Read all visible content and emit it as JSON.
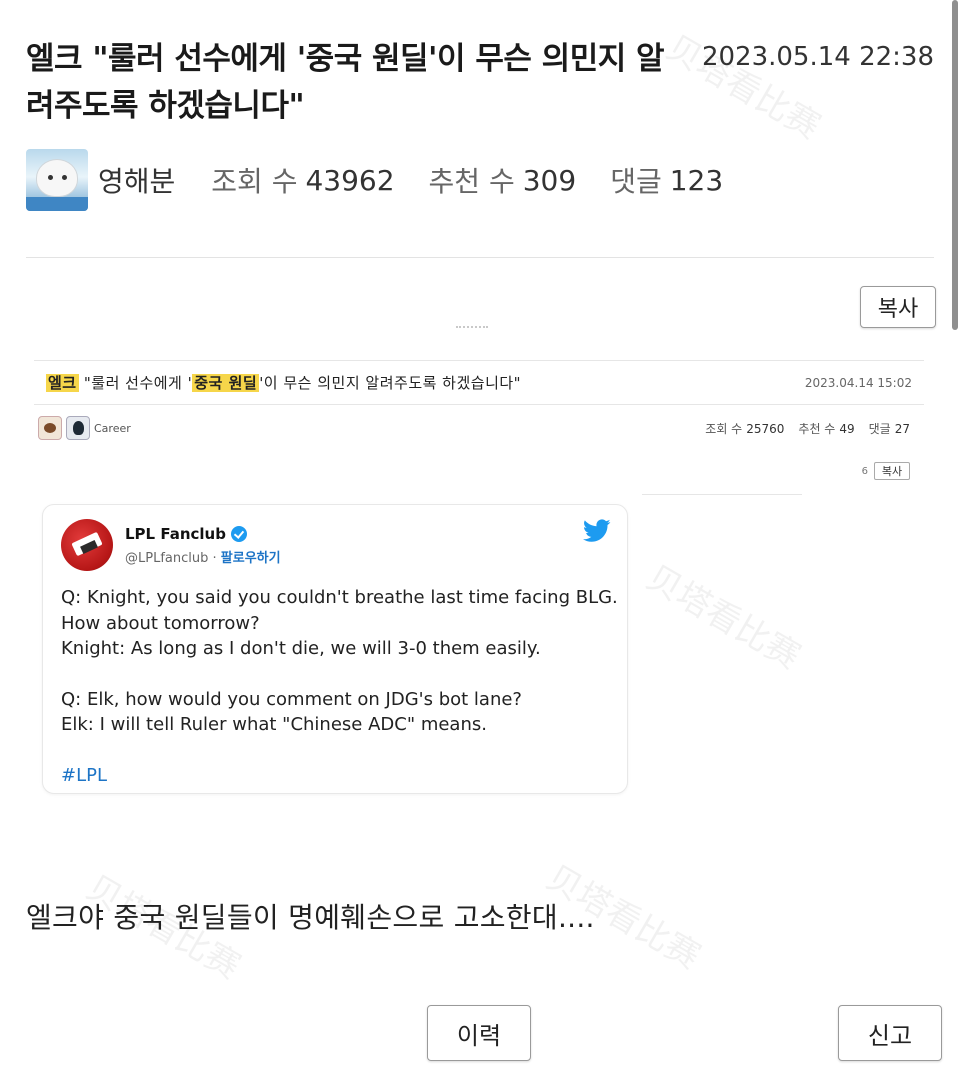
{
  "post": {
    "title": "엘크 \"룰러 선수에게 '중국 원딜'이 무슨 의민지 알려주도록 하겠습니다\"",
    "date": "2023.05.14 22:38",
    "author": "영해분",
    "views_label": "조회 수",
    "views": "43962",
    "likes_label": "추천 수",
    "likes": "309",
    "comments_label": "댓글",
    "comments": "123",
    "copy_button": "복사",
    "body_comment": "엘크야 중국 원딜들이 명예훼손으로 고소한대...."
  },
  "embedded": {
    "title_prefix": "엘크",
    "title_part1": " \"룰러 선수에게 '",
    "title_highlight": "중국 원딜",
    "title_part2": "'이 무슨 의민지 알려주도록 하겠습니다\"",
    "date": "2023.04.14 15:02",
    "author": "Career",
    "views_label": "조회 수",
    "views": "25760",
    "likes_label": "추천 수",
    "likes": "49",
    "comments_label": "댓글",
    "comments": "27",
    "copy_count": "6",
    "copy_button": "복사"
  },
  "tweet": {
    "name": "LPL Fanclub",
    "handle": "@LPLfanclub",
    "separator": "·",
    "follow": "팔로우하기",
    "line1": "Q: Knight, you said you couldn't breathe last time facing BLG. How about tomorrow?",
    "line2": "Knight: As long as I don't die, we will 3-0 them easily.",
    "line3": "Q: Elk, how would you comment on JDG's bot lane?",
    "line4": "Elk: I will tell Ruler what \"Chinese ADC\" means.",
    "hashtag": "#LPL"
  },
  "footer": {
    "history_button": "이력",
    "report_button": "신고"
  },
  "colors": {
    "highlight": "#f6d64a",
    "twitter_blue": "#1d9bf0",
    "link_blue": "#1d74c6"
  }
}
